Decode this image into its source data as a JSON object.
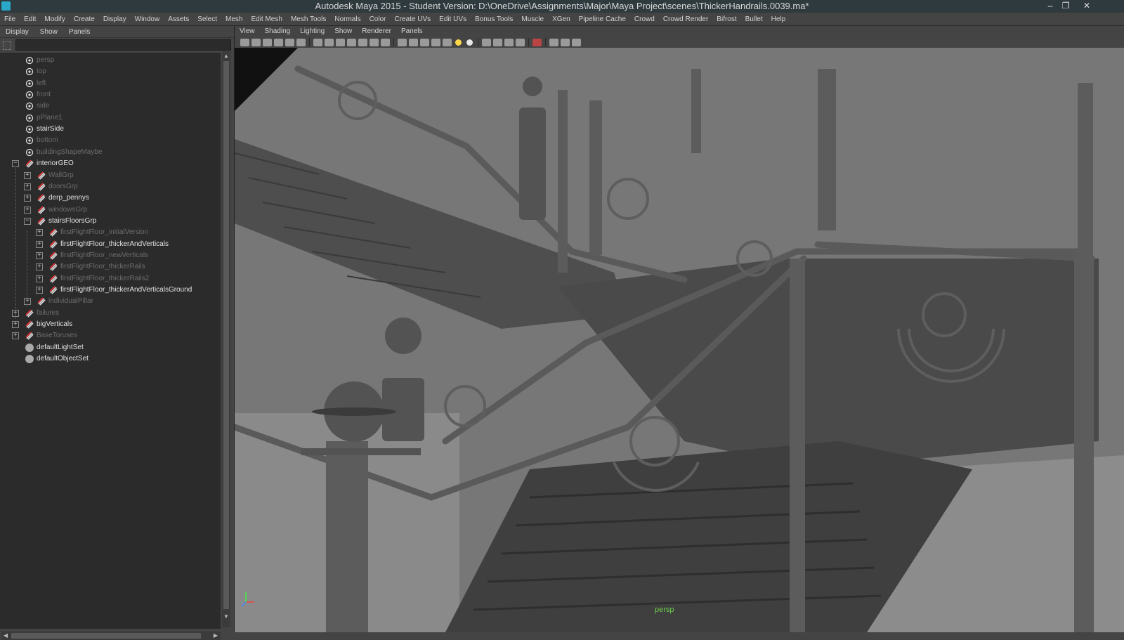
{
  "window": {
    "title": "Autodesk Maya 2015 - Student Version: D:\\OneDrive\\Assignments\\Major\\Maya Project\\scenes\\ThickerHandrails.0039.ma*",
    "buttons": {
      "minimize": "–",
      "restore": "❐",
      "close": "✕"
    }
  },
  "main_menu": [
    "File",
    "Edit",
    "Modify",
    "Create",
    "Display",
    "Window",
    "Assets",
    "Select",
    "Mesh",
    "Edit Mesh",
    "Mesh Tools",
    "Normals",
    "Color",
    "Create UVs",
    "Edit UVs",
    "Bonus Tools",
    "Muscle",
    "XGen",
    "Pipeline Cache",
    "Crowd",
    "Crowd Render",
    "Bifrost",
    "Bullet",
    "Help"
  ],
  "outliner": {
    "menu": [
      "Display",
      "Show",
      "Panels"
    ],
    "filter_value": "",
    "items": [
      {
        "label": "persp",
        "icon": "camera-icon",
        "state": "dim"
      },
      {
        "label": "top",
        "icon": "camera-icon",
        "state": "dim"
      },
      {
        "label": "left",
        "icon": "camera-icon",
        "state": "dim"
      },
      {
        "label": "front",
        "icon": "camera-icon",
        "state": "dim"
      },
      {
        "label": "side",
        "icon": "camera-icon",
        "state": "dim"
      },
      {
        "label": "pPlane1",
        "icon": "mesh-icon",
        "state": "dim"
      },
      {
        "label": "stairSide",
        "icon": "camera-icon",
        "state": "bright"
      },
      {
        "label": "bottom",
        "icon": "camera-icon",
        "state": "dim"
      },
      {
        "label": "buildingShapeMaybe",
        "icon": "mesh-icon",
        "state": "dim"
      },
      {
        "label": "interiorGEO",
        "icon": "group-icon",
        "state": "bright",
        "expander": "−"
      },
      {
        "label": "WallGrp",
        "icon": "group-icon",
        "state": "dim",
        "expander": "+"
      },
      {
        "label": "doorsGrp",
        "icon": "group-icon",
        "state": "dim",
        "expander": "+"
      },
      {
        "label": "derp_pennys",
        "icon": "group-icon",
        "state": "bright",
        "expander": "+"
      },
      {
        "label": "windowsGrp",
        "icon": "group-icon",
        "state": "dim",
        "expander": "+"
      },
      {
        "label": "stairsFloorsGrp",
        "icon": "group-icon",
        "state": "bright",
        "expander": "−"
      },
      {
        "label": "firstFlightFloor_initialVersion",
        "icon": "group-icon",
        "state": "dim",
        "expander": "+"
      },
      {
        "label": "firstFlightFloor_thickerAndVerticals",
        "icon": "group-icon",
        "state": "bright",
        "expander": "+"
      },
      {
        "label": "firstFlightFloor_newVerticals",
        "icon": "group-icon",
        "state": "dim",
        "expander": "+"
      },
      {
        "label": "firstFlightFloor_thickerRails",
        "icon": "group-icon",
        "state": "dim",
        "expander": "+"
      },
      {
        "label": "firstFlightFloor_thickerRails2",
        "icon": "group-icon",
        "state": "dim",
        "expander": "+"
      },
      {
        "label": "firstFlightFloor_thickerAndVerticalsGround",
        "icon": "group-icon",
        "state": "bright",
        "expander": "+"
      },
      {
        "label": "individualPillar",
        "icon": "group-icon",
        "state": "dim",
        "expander": "+"
      },
      {
        "label": "failures",
        "icon": "group-icon",
        "state": "dim",
        "expander": "+"
      },
      {
        "label": "bigVerticals",
        "icon": "group-icon",
        "state": "bright",
        "expander": "+"
      },
      {
        "label": "BaseToruses",
        "icon": "group-icon",
        "state": "dim",
        "expander": "+"
      },
      {
        "label": "defaultLightSet",
        "icon": "set-icon",
        "state": "bright"
      },
      {
        "label": "defaultObjectSet",
        "icon": "set-icon",
        "state": "bright"
      }
    ]
  },
  "viewport": {
    "menu": [
      "View",
      "Shading",
      "Lighting",
      "Show",
      "Renderer",
      "Panels"
    ],
    "camera_label": "persp"
  }
}
